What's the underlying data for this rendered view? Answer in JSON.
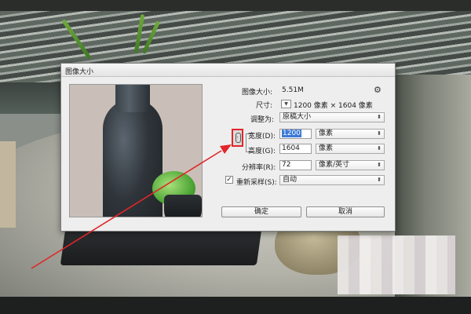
{
  "dialog": {
    "title": "图像大小",
    "image_size_label": "图像大小:",
    "image_size_value": "5.51M",
    "dimensions_label": "尺寸:",
    "dimensions_value": "1200 像素 × 1604 像素",
    "fit_label": "调整为:",
    "fit_value": "原稿大小",
    "width_label": "宽度(D):",
    "width_value": "1200",
    "width_unit": "像素",
    "height_label": "高度(G):",
    "height_value": "1604",
    "height_unit": "像素",
    "resolution_label": "分辨率(R):",
    "resolution_value": "72",
    "resolution_unit": "像素/英寸",
    "resample_checked": true,
    "resample_label": "重新采样(S):",
    "resample_value": "自动",
    "ok_label": "确定",
    "cancel_label": "取消"
  },
  "icons": {
    "gear": "gear-icon",
    "chain": "chain-link-icon",
    "dropdown": "chevron-down-icon"
  },
  "colors": {
    "highlight": "#e0262a",
    "selection": "#3b79d6"
  }
}
